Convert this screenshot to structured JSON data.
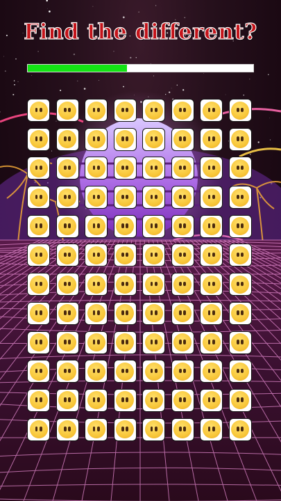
{
  "game": {
    "title": "Find the different?",
    "progress_fraction": 0.44,
    "grid": {
      "rows": 12,
      "columns": 8,
      "tile_icon": "emoji-face-without-mouth-icon"
    }
  },
  "colors": {
    "title_fill": "#c4141a",
    "title_outline": "#ffffff",
    "progress_fill": "#14e414",
    "progress_track": "#ffffff",
    "face_yellow": "#f8c73a",
    "tile_border": "#111111"
  }
}
